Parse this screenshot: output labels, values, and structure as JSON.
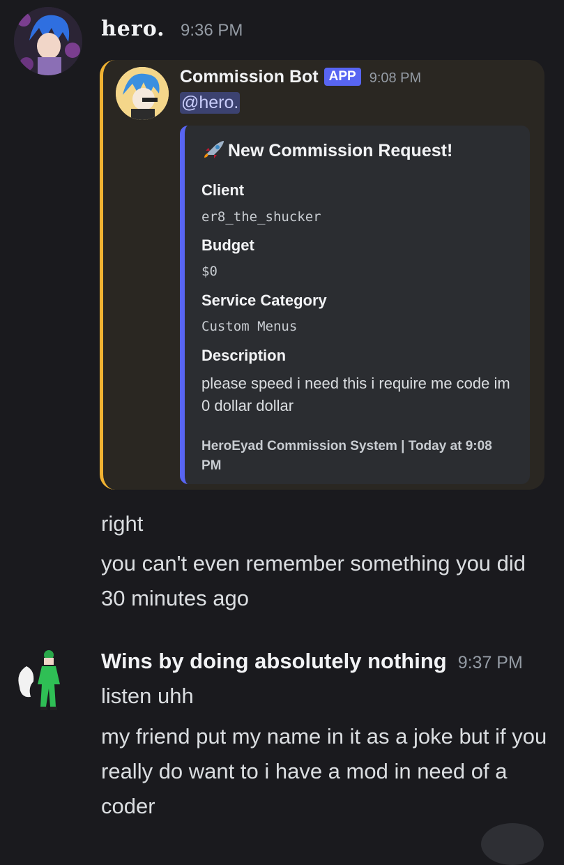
{
  "messages": [
    {
      "username": "hero.",
      "timestamp": "9:36 PM",
      "forwarded": {
        "bot_name": "Commission Bot",
        "bot_tag": "APP",
        "timestamp": "9:08 PM",
        "mention": "@hero.",
        "embed": {
          "title": "New Commission Request!",
          "title_icon": "rocket-icon",
          "accent_color": "#5865f2",
          "fields": [
            {
              "name": "Client",
              "value": "er8_the_shucker"
            },
            {
              "name": "Budget",
              "value": "$0"
            },
            {
              "name": "Service Category",
              "value": "Custom Menus"
            },
            {
              "name": "Description",
              "value": "please speed i need this i require me code im 0 dollar dollar"
            }
          ],
          "footer": "HeroEyad Commission System | Today at 9:08 PM"
        }
      },
      "lines": [
        "right",
        "you can't even remember something you did 30 minutes ago"
      ]
    },
    {
      "username": "Wins by doing absolutely nothing",
      "timestamp": "9:37 PM",
      "lines": [
        "listen uhh",
        "my friend put my name in it as a joke but if you really do want to i have a mod in need of a coder"
      ]
    }
  ],
  "colors": {
    "background": "#1a1a1e",
    "forward_bar": "#f0b232",
    "app_tag": "#5865f2"
  }
}
